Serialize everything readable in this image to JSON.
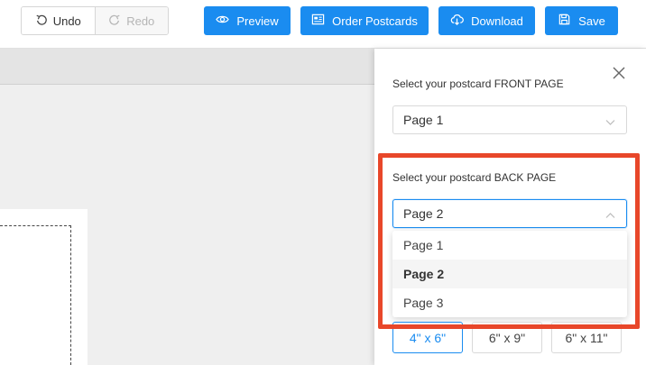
{
  "toolbar": {
    "undo_label": "Undo",
    "redo_label": "Redo",
    "preview_label": "Preview",
    "order_label": "Order Postcards",
    "download_label": "Download",
    "save_label": "Save",
    "primary_color": "#1a8cf0"
  },
  "panel": {
    "front_label": "Select your postcard FRONT PAGE",
    "front_value": "Page 1",
    "back_label": "Select your postcard BACK PAGE",
    "back_value": "Page 2",
    "back_options": [
      "Page 1",
      "Page 2",
      "Page 3"
    ],
    "back_selected_index": 1,
    "sizes": [
      "4\" x 6\"",
      "6\" x 9\"",
      "6\" x 11\""
    ],
    "active_size_index": 0,
    "highlight_color": "#e8472a"
  }
}
